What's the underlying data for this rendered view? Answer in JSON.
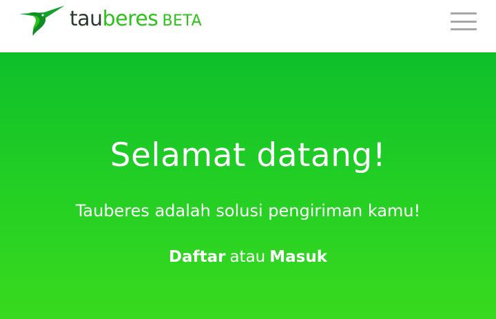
{
  "header": {
    "brand_prefix": "tau",
    "brand_suffix": "beres",
    "brand_badge": "BETA",
    "menu_icon": "hamburger-menu-icon",
    "logo_icon": "hummingbird-logo-icon"
  },
  "hero": {
    "title": "Selamat datang!",
    "subtitle": "Tauberes adalah solusi pengiriman kamu!",
    "register_label": "Daftar",
    "separator": "atau",
    "login_label": "Masuk"
  },
  "colors": {
    "brand_green": "#2cc21a",
    "hero_top": "#0ebf2a",
    "hero_bottom": "#38da1e",
    "brand_dark": "#2b3a2f",
    "menu_gray": "#a6a6a6"
  }
}
